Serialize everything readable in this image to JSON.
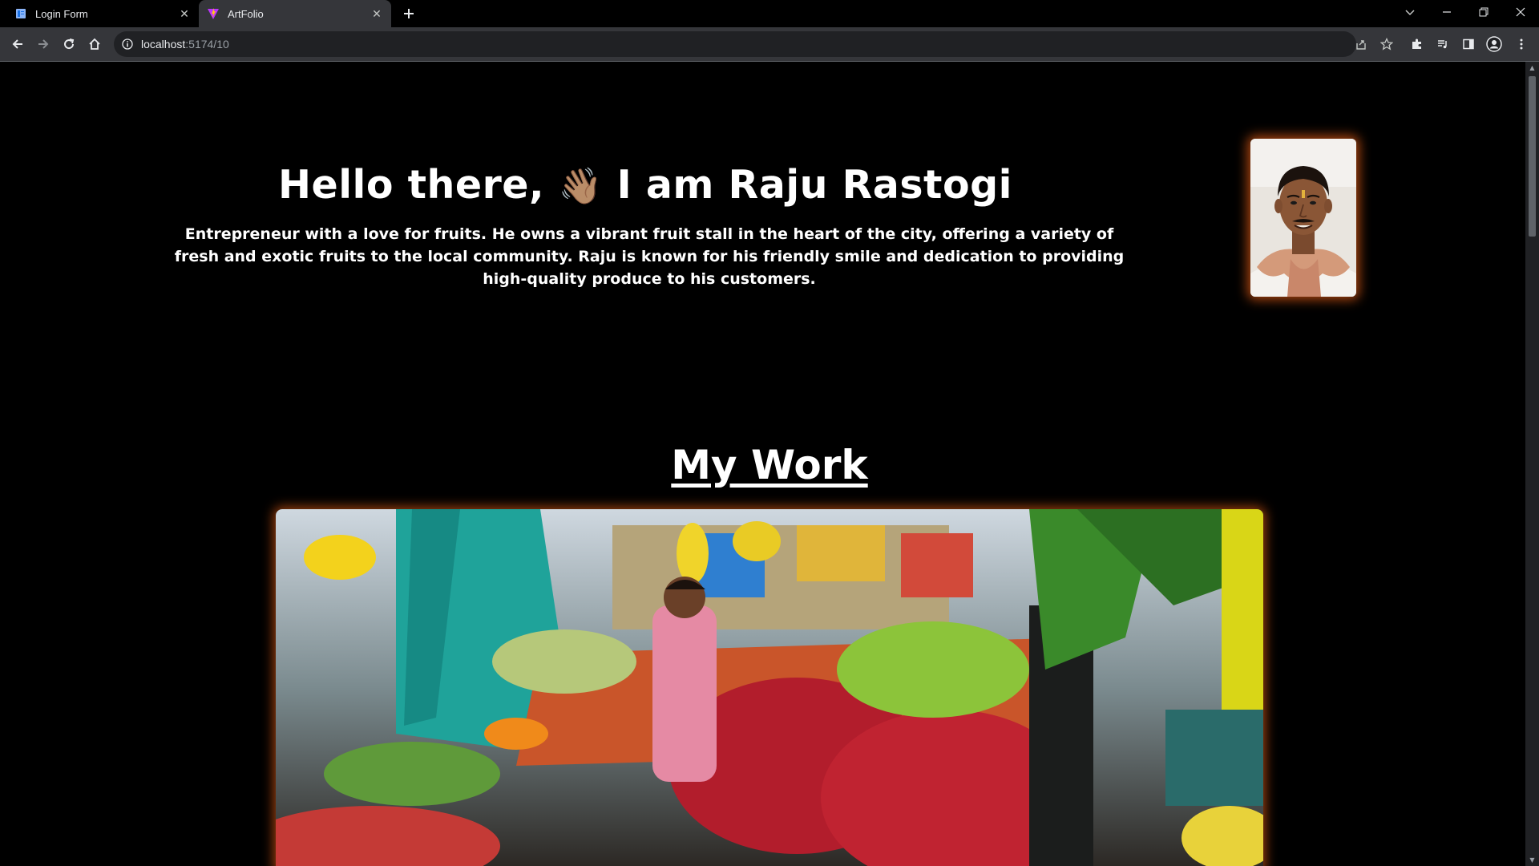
{
  "browser": {
    "tabs": [
      {
        "title": "Login Form",
        "active": false,
        "icon": "document-icon"
      },
      {
        "title": "ArtFolio",
        "active": true,
        "icon": "vite-icon"
      }
    ],
    "address": {
      "host": "localhost",
      "path": ":5174/10"
    }
  },
  "hero": {
    "greeting": "Hello there,",
    "emoji": "👋🏽",
    "name_line": "I am Raju Rastogi",
    "description": "Entrepreneur with a love for fruits. He owns a vibrant fruit stall in the heart of the city, offering a variety of fresh and exotic fruits to the local community. Raju is known for his friendly smile and dedication to providing high-quality produce to his customers."
  },
  "work": {
    "title": "My Work"
  },
  "colors": {
    "accent_glow": "#dc5a14",
    "page_bg": "#000000",
    "chrome_bg": "#35363a"
  }
}
